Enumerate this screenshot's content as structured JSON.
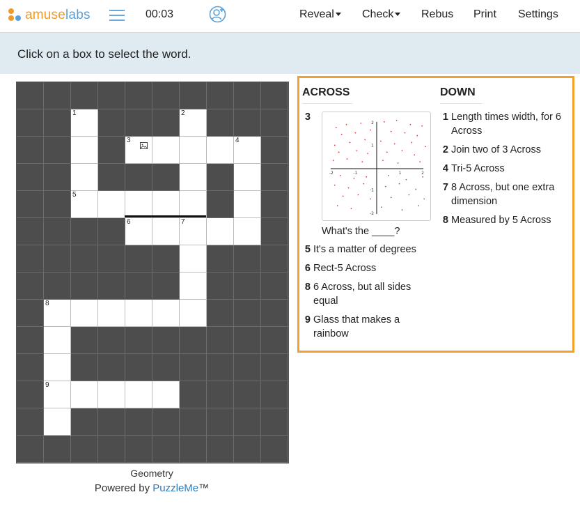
{
  "header": {
    "logo_text_a": "amuse",
    "logo_text_b": "labs",
    "timer": "00:03",
    "menu": {
      "reveal": "Reveal",
      "check": "Check",
      "rebus": "Rebus",
      "print": "Print",
      "settings": "Settings"
    }
  },
  "banner": {
    "text": "Click on a box to select the word."
  },
  "grid": {
    "numbers": {
      "1": "1",
      "2": "2",
      "3": "3",
      "4": "4",
      "5": "5",
      "6": "6",
      "7": "7",
      "8": "8",
      "9": "9"
    }
  },
  "footer": {
    "title": "Geometry",
    "powered_prefix": "Powered by ",
    "powered_link": "PuzzleMe",
    "powered_suffix": "™"
  },
  "clues": {
    "across_title": "ACROSS",
    "down_title": "DOWN",
    "across": [
      {
        "num": "3",
        "text": "What's the ____?",
        "has_image": true
      },
      {
        "num": "5",
        "text": "It's a matter of degrees"
      },
      {
        "num": "6",
        "text": "Rect-5 Across"
      },
      {
        "num": "8",
        "text": "6 Across, but all sides equal"
      },
      {
        "num": "9",
        "text": "Glass that makes a rainbow"
      }
    ],
    "down": [
      {
        "num": "1",
        "text": "Length times width, for 6 Across"
      },
      {
        "num": "2",
        "text": "Join two of 3 Across"
      },
      {
        "num": "4",
        "text": "Tri-5 Across"
      },
      {
        "num": "7",
        "text": "8 Across, but one extra dimension"
      },
      {
        "num": "8",
        "text": "Measured by 5 Across"
      }
    ],
    "image_axis_ticks": {
      "x_min": "-2",
      "x_neg1": "-1",
      "x_pos1": "1",
      "x_max": "2",
      "y_max": "2",
      "y_pos1": "1",
      "y_neg1": "-1",
      "y_min": "-2"
    }
  },
  "colors": {
    "accent_orange": "#f3a12a",
    "brand_blue": "#5aa0d8",
    "link_blue": "#2e7bbd",
    "banner_bg": "#dfeaf1",
    "black_cell": "#4d4d4d"
  },
  "icons": {
    "menu": "hamburger-icon",
    "add_user": "add-user-icon",
    "clue_image": "image-icon"
  }
}
